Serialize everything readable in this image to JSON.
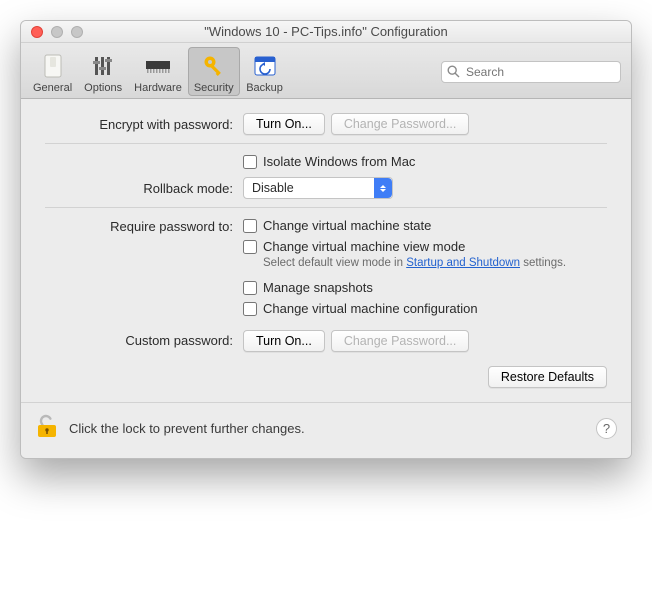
{
  "window": {
    "title": "\"Windows 10 - PC-Tips.info\" Configuration"
  },
  "toolbar": {
    "tabs": [
      {
        "label": "General"
      },
      {
        "label": "Options"
      },
      {
        "label": "Hardware"
      },
      {
        "label": "Security"
      },
      {
        "label": "Backup"
      }
    ],
    "search_placeholder": "Search"
  },
  "encrypt": {
    "label": "Encrypt with password:",
    "turn_on": "Turn On...",
    "change": "Change Password..."
  },
  "isolate": {
    "label": "Isolate Windows from Mac"
  },
  "rollback": {
    "label": "Rollback mode:",
    "value": "Disable"
  },
  "require": {
    "label": "Require password to:",
    "opts": [
      "Change virtual machine state",
      "Change virtual machine view mode",
      "Manage snapshots",
      "Change virtual machine configuration"
    ],
    "hint_pre": "Select default view mode in ",
    "hint_link": "Startup and Shutdown",
    "hint_post": " settings."
  },
  "custom": {
    "label": "Custom password:",
    "turn_on": "Turn On...",
    "change": "Change Password..."
  },
  "restore": "Restore Defaults",
  "footer": {
    "text": "Click the lock to prevent further changes."
  }
}
